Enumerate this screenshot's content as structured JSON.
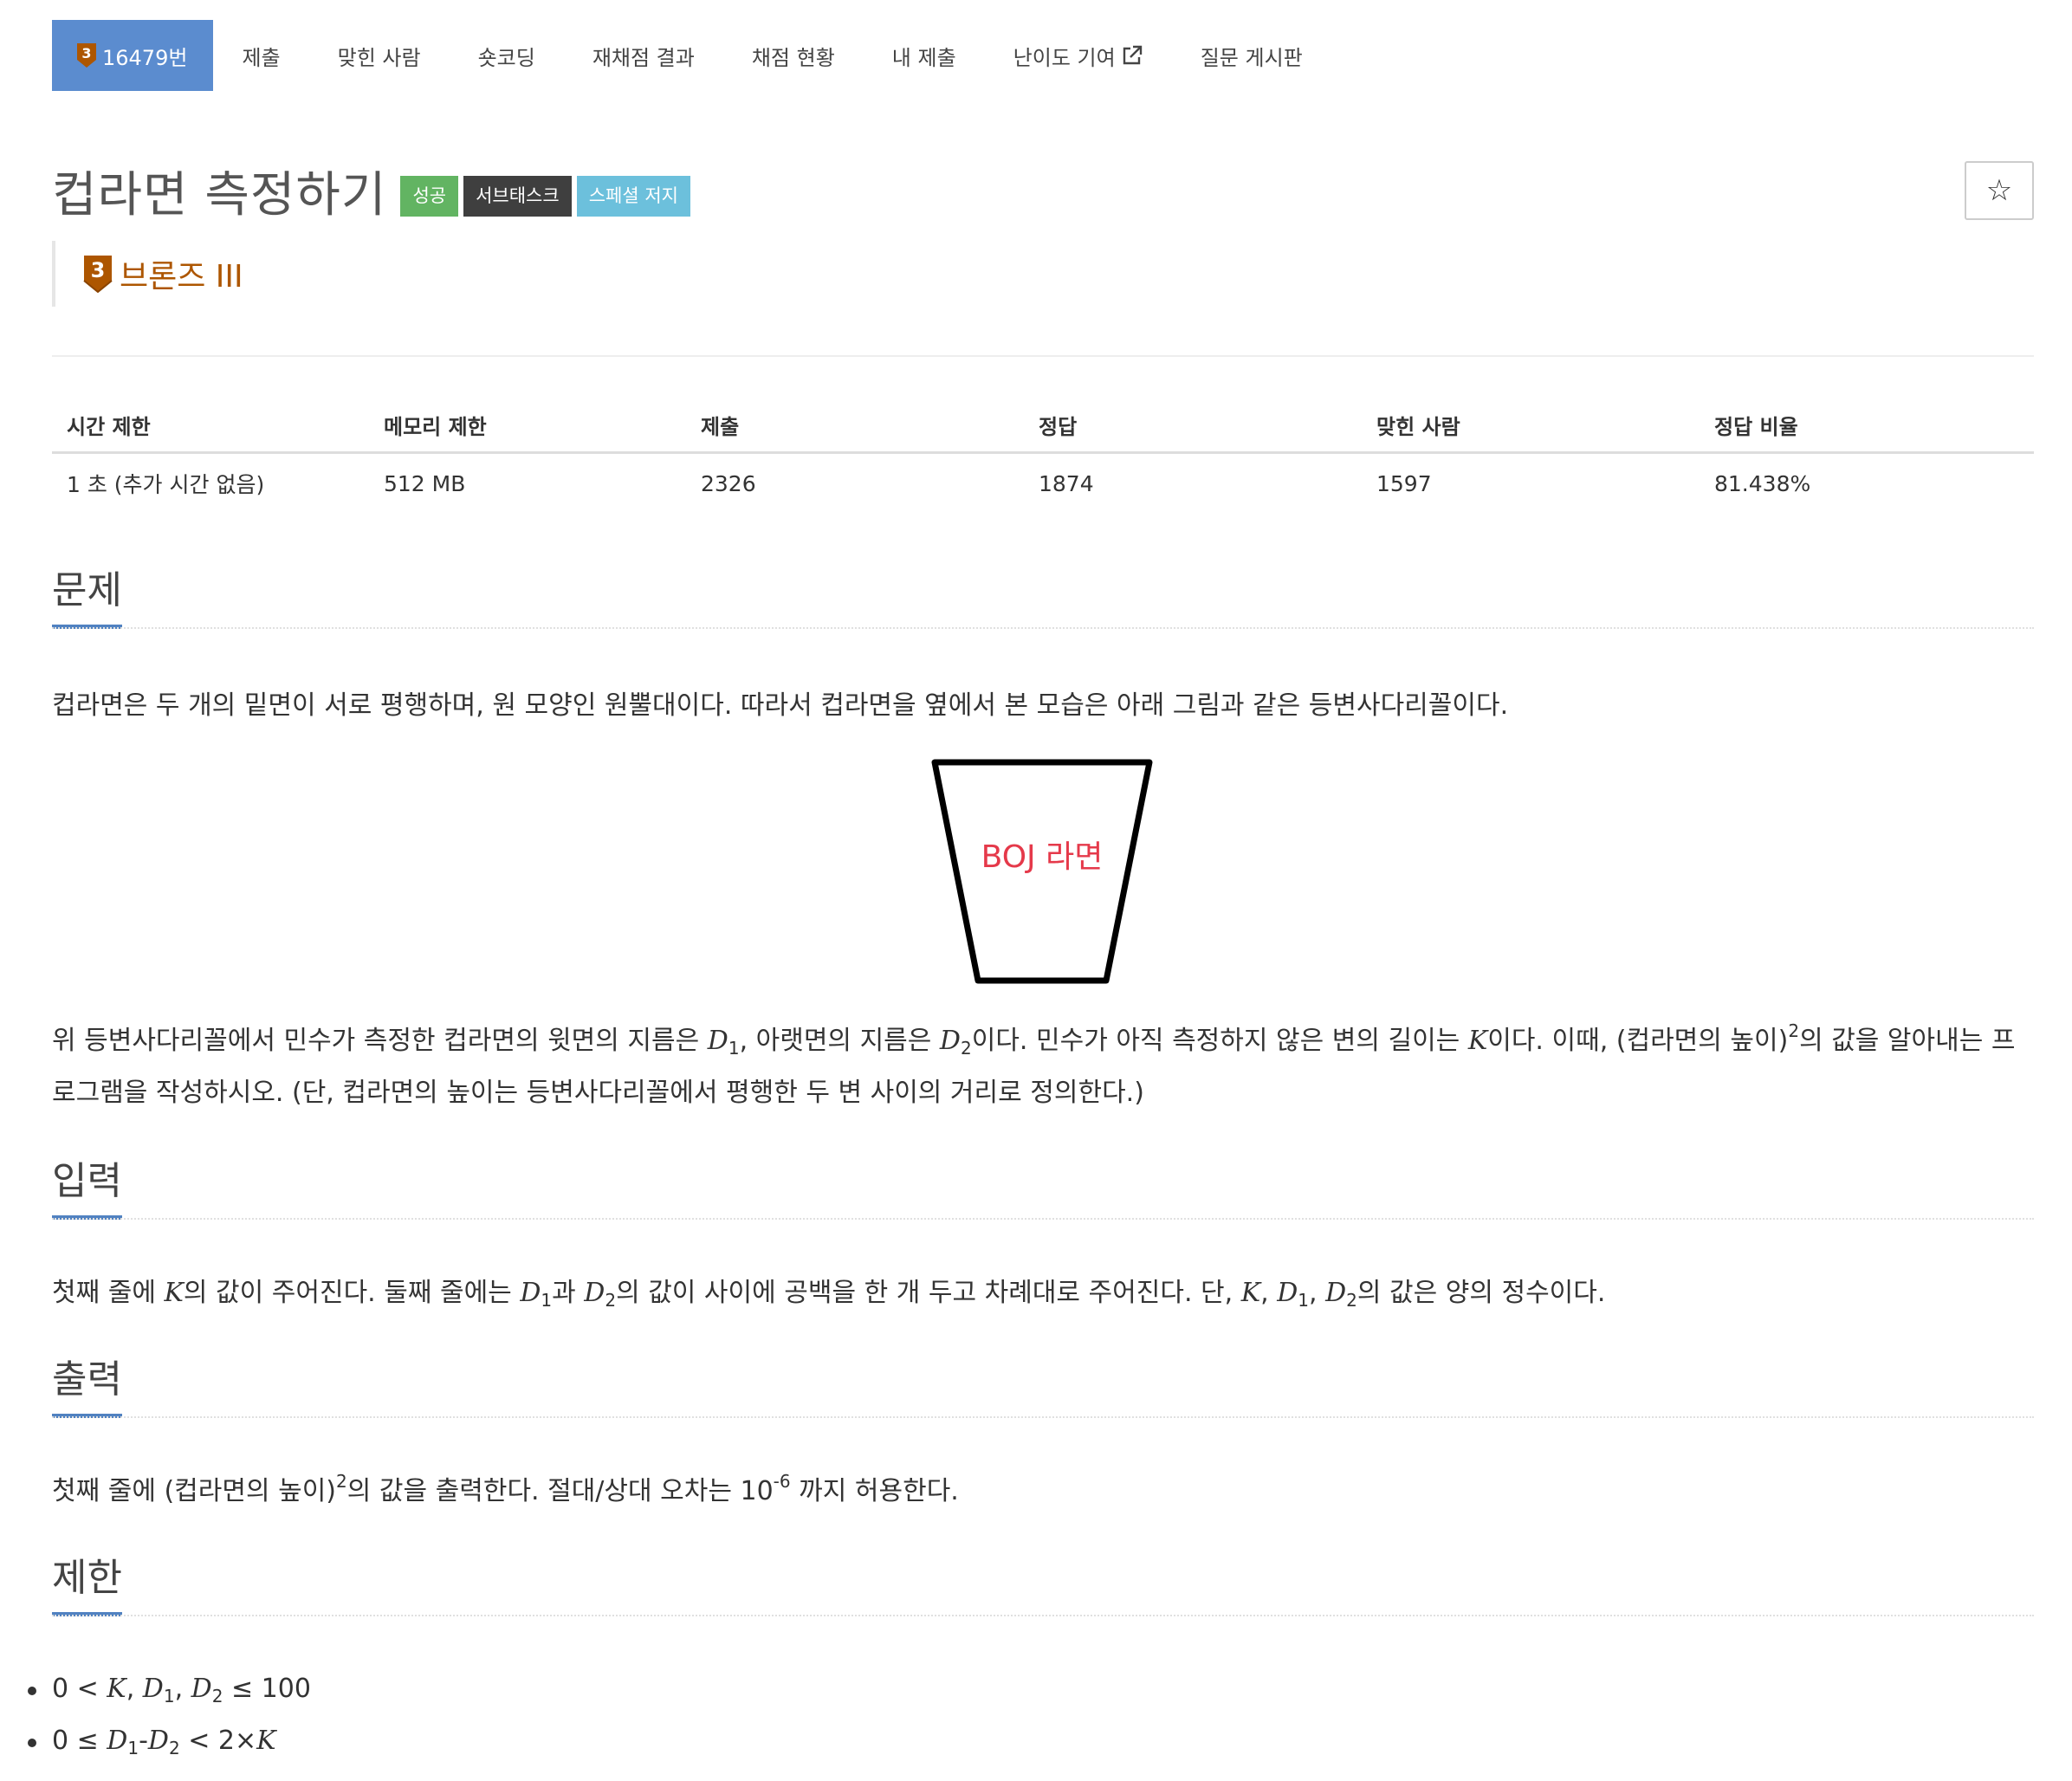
{
  "nav": {
    "problem_id": "16479번",
    "tier_num": "3",
    "items": [
      "제출",
      "맞힌 사람",
      "숏코딩",
      "재채점 결과",
      "채점 현황",
      "내 제출",
      "난이도 기여",
      "질문 게시판"
    ]
  },
  "problem": {
    "title": "컵라면 측정하기",
    "badges": [
      "성공",
      "서브태스크",
      "스페셜 저지"
    ],
    "tier": "브론즈 III",
    "star": "☆"
  },
  "stats": {
    "headers": [
      "시간 제한",
      "메모리 제한",
      "제출",
      "정답",
      "맞힌 사람",
      "정답 비율"
    ],
    "values": [
      "1 초 (추가 시간 없음)",
      "512 MB",
      "2326",
      "1874",
      "1597",
      "81.438%"
    ]
  },
  "sections": {
    "problem": "문제",
    "input": "입력",
    "output": "출력",
    "limits": "제한"
  },
  "figure": {
    "label": "BOJ 라면"
  },
  "text": {
    "intro": "컵라면은 두 개의 밑면이 서로 평행하며, 원 모양인 원뿔대이다. 따라서 컵라면을 옆에서 본 모습은 아래 그림과 같은 등변사다리꼴이다.",
    "desc_1": "위 등변사다리꼴에서 민수가 측정한 컵라면의 윗면의 지름은 ",
    "desc_2": ", 아랫면의 지름은 ",
    "desc_3": "이다. 민수가 아직 측정하지 않은 변의 길이는 ",
    "desc_4": "이다. 이때, (컵라면의 높이)",
    "desc_5": "의 값을 알아내는 프로그램을 작성하시오. (단, 컵라면의 높이는 등변사다리꼴에서 평행한 두 변 사이의 거리로 정의한다.)",
    "input_1": "첫째 줄에 ",
    "input_2": "의 값이 주어진다. 둘째 줄에는 ",
    "input_3": "과 ",
    "input_4": "의 값이 사이에 공백을 한 개 두고 차례대로 주어진다. 단, ",
    "input_5": "의 값은 양의 정수이다.",
    "output_1": "첫째 줄에 (컵라면의 높이)",
    "output_2": "의 값을 출력한다. 절대/상대 오차는 10",
    "output_3": " 까지 허용한다.",
    "exp_2": "2",
    "exp_neg6": "-6",
    "var_K": "K",
    "var_D": "D",
    "sub_1": "1",
    "sub_2": "2",
    "sep": ", ",
    "limit1_pre": "0 < ",
    "limit1_post": " ≤ 100",
    "limit2_pre": "0 ≤ ",
    "limit2_minus": "-",
    "limit2_mid": " < 2×"
  },
  "colors": {
    "nav_active": "#5b8ccf",
    "success": "#62b462",
    "subtask": "#3f3f3f",
    "special": "#6cc0dc",
    "bronze": "#ad5600",
    "section_underline": "#5182c1",
    "figure_label": "#e5394a"
  }
}
